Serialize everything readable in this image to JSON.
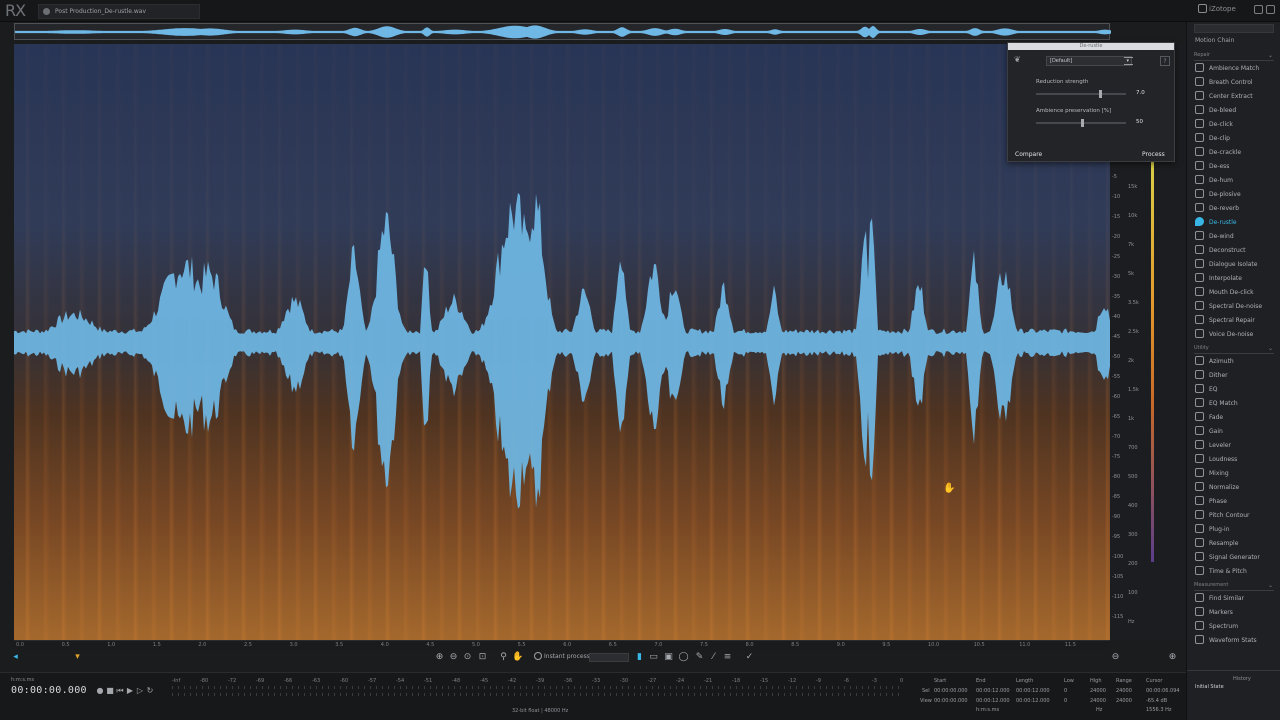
{
  "app": {
    "logo": "RX",
    "file_tab": "Post Production_De-rustle.wav",
    "brand": "iZotope"
  },
  "derustle": {
    "title": "De-rustle",
    "preset": "[Default]",
    "help": "?",
    "reduction_label": "Reduction strength",
    "reduction_value": "7.0",
    "reduction_fraction": 0.7,
    "ambience_label": "Ambience preservation [%]",
    "ambience_value": "50",
    "ambience_fraction": 0.5,
    "compare": "Compare",
    "process": "Process"
  },
  "modules": {
    "motion": "Motion Chain",
    "repair_header": "Repair",
    "repair": [
      "Ambience Match",
      "Breath Control",
      "Center Extract",
      "De-bleed",
      "De-click",
      "De-clip",
      "De-crackle",
      "De-ess",
      "De-hum",
      "De-plosive",
      "De-reverb",
      "De-rustle",
      "De-wind",
      "Deconstruct",
      "Dialogue Isolate",
      "Interpolate",
      "Mouth De-click",
      "Spectral De-noise",
      "Spectral Repair",
      "Voice De-noise"
    ],
    "active": "De-rustle",
    "utility_header": "Utility",
    "utility": [
      "Azimuth",
      "Dither",
      "EQ",
      "EQ Match",
      "Fade",
      "Gain",
      "Leveler",
      "Loudness",
      "Mixing",
      "Normalize",
      "Phase",
      "Pitch Contour",
      "Plug-in",
      "Resample",
      "Signal Generator",
      "Time & Pitch"
    ],
    "measurement_header": "Measurement",
    "measurement": [
      "Find Similar",
      "Markers",
      "Spectrum",
      "Waveform Stats"
    ],
    "history_header": "History",
    "history_item": "Initial State"
  },
  "freq_ticks": [
    "15k",
    "10k",
    "7k",
    "5k",
    "3.5k",
    "2.5k",
    "2k",
    "1.5k",
    "1k",
    "700",
    "500",
    "400",
    "300",
    "200",
    "100",
    "Hz"
  ],
  "db_ticks": [
    "-5",
    "-10",
    "-15",
    "-20",
    "-25",
    "-30",
    "-35",
    "-40",
    "-45",
    "-50",
    "-55",
    "-60",
    "-65",
    "-70",
    "-75",
    "-80",
    "-85",
    "-90",
    "-95",
    "-100",
    "-105",
    "-110",
    "-115"
  ],
  "time_ticks": [
    "0.0",
    "0.5",
    "1.0",
    "1.5",
    "2.0",
    "2.5",
    "3.0",
    "3.5",
    "4.0",
    "4.5",
    "5.0",
    "5.5",
    "6.0",
    "6.5",
    "7.0",
    "7.5",
    "8.0",
    "8.5",
    "9.0",
    "9.5",
    "10.0",
    "10.5",
    "11.0",
    "11.5"
  ],
  "toolbar": {
    "instant_process": "Instant process"
  },
  "transport": {
    "timecode_label": "h:m:s.ms",
    "timecode": "00:00:00.000",
    "format": "32-bit float | 48000 Hz",
    "level_ticks": [
      "-Inf",
      "-80",
      "-72",
      "-69",
      "-66",
      "-63",
      "-60",
      "-57",
      "-54",
      "-51",
      "-48",
      "-45",
      "-42",
      "-39",
      "-36",
      "-33",
      "-30",
      "-27",
      "-24",
      "-21",
      "-18",
      "-15",
      "-12",
      "-9",
      "-6",
      "-3",
      "0"
    ]
  },
  "selection": {
    "headers": [
      "Start",
      "End",
      "Length",
      "Low",
      "High",
      "Range",
      "Cursor"
    ],
    "sel_label": "Sel",
    "view_label": "View",
    "sel_row": [
      "00:00:00.000",
      "00:00:12.000",
      "00:00:12.000",
      "0",
      "24000",
      "24000",
      "00:00:06.094"
    ],
    "view_row": [
      "00:00:00.000",
      "00:00:12.000",
      "00:00:12.000",
      "0",
      "24000",
      "24000",
      "-65.4 dB"
    ],
    "units": "h:m:s.ms",
    "hz": "Hz",
    "cursor_extra": "1556.3 Hz"
  },
  "colors": {
    "accent": "#38b7e6",
    "waveform": "#6fb8e6",
    "background": "#1b1c1e"
  }
}
